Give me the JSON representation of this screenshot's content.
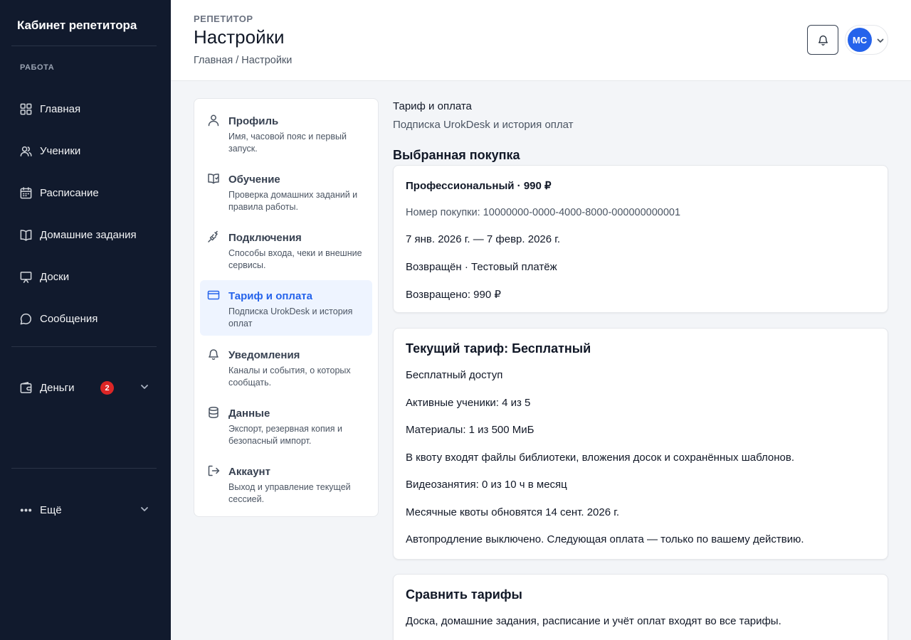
{
  "sidebar": {
    "brand": "Кабинет репетитора",
    "section_label": "РАБОТА",
    "items": [
      {
        "label": "Главная",
        "icon": "grid-icon"
      },
      {
        "label": "Ученики",
        "icon": "users-icon"
      },
      {
        "label": "Расписание",
        "icon": "calendar-icon"
      },
      {
        "label": "Домашние задания",
        "icon": "book-icon"
      },
      {
        "label": "Доски",
        "icon": "presentation-icon"
      },
      {
        "label": "Сообщения",
        "icon": "chat-icon"
      }
    ],
    "money": {
      "label": "Деньги",
      "badge": "2",
      "icon": "wallet-icon"
    },
    "more": {
      "label": "Ещё",
      "icon": "dots-icon"
    }
  },
  "header": {
    "eyebrow": "РЕПЕТИТОР",
    "title": "Настройки",
    "breadcrumb": "Главная / Настройки",
    "avatar_initials": "МС",
    "accent": "#2563eb"
  },
  "settings_nav": [
    {
      "title": "Профиль",
      "desc": "Имя, часовой пояс и первый запуск.",
      "icon": "user-icon"
    },
    {
      "title": "Обучение",
      "desc": "Проверка домашних заданий и правила работы.",
      "icon": "book-open-icon"
    },
    {
      "title": "Подключения",
      "desc": "Способы входа, чеки и внешние сервисы.",
      "icon": "plug-icon"
    },
    {
      "title": "Тариф и оплата",
      "desc": "Подписка UrokDesk и история оплат",
      "icon": "credit-card-icon",
      "active": true
    },
    {
      "title": "Уведомления",
      "desc": "Каналы и события, о которых сообщать.",
      "icon": "bell-icon"
    },
    {
      "title": "Данные",
      "desc": "Экспорт, резервная копия и безопасный импорт.",
      "icon": "database-icon"
    },
    {
      "title": "Аккаунт",
      "desc": "Выход и управление текущей сессией.",
      "icon": "logout-icon"
    }
  ],
  "main": {
    "section_title": "Тариф и оплата",
    "section_subtitle": "Подписка UrokDesk и история оплат",
    "purchase_heading": "Выбранная покупка",
    "purchase": {
      "title": "Профессиональный · 990 ₽",
      "number": "Номер покупки: 10000000-0000-4000-8000-000000000001",
      "period": "7 янв. 2026 г. — 7 февр. 2026 г.",
      "status": "Возвращён · Тестовый платёж",
      "refunded": "Возвращено: 990 ₽"
    },
    "current_plan": {
      "title": "Текущий тариф: Бесплатный",
      "lines": [
        "Бесплатный доступ",
        "Активные ученики: 4 из 5",
        "Материалы: 1 из 500 МиБ",
        "В квоту входят файлы библиотеки, вложения досок и сохранённых шаблонов.",
        "Видеозанятия: 0 из 10 ч в месяц",
        "Месячные квоты обновятся 14 сент. 2026 г.",
        "Автопродление выключено. Следующая оплата — только по вашему действию."
      ]
    },
    "compare": {
      "title": "Сравнить тарифы",
      "text": "Доска, домашние задания, расписание и учёт оплат входят во все тарифы."
    }
  }
}
